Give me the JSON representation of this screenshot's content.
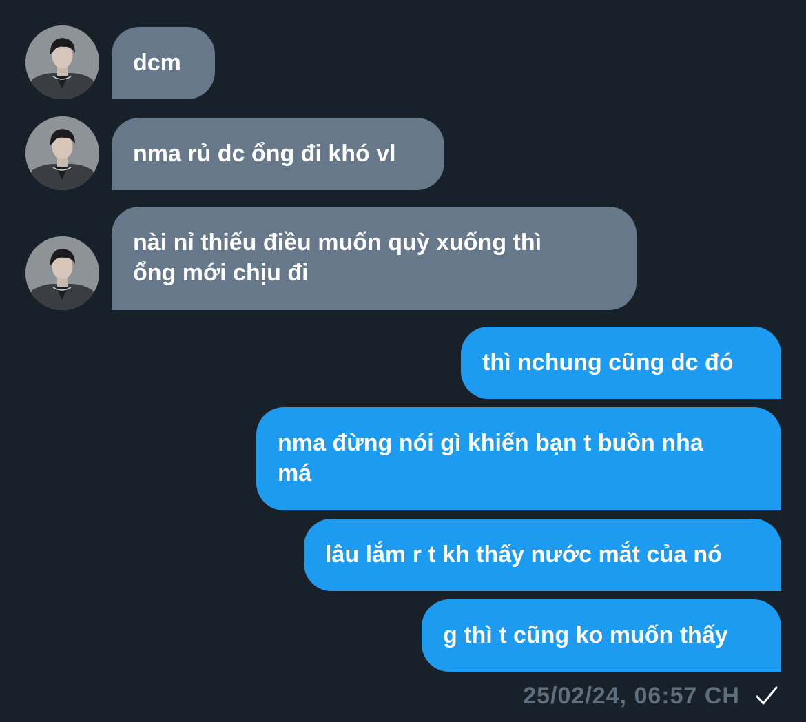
{
  "messages": {
    "incoming": [
      {
        "text": "dcm"
      },
      {
        "text": "nma rủ dc ổng đi khó vl"
      },
      {
        "line1": "nài nỉ thiếu điều muốn quỳ xuống thì",
        "line2": "ổng mới chịu đi"
      }
    ],
    "outgoing": [
      {
        "text": "thì nchung cũng dc đó"
      },
      {
        "line1": "nma đừng nói gì khiến bạn t buồn nha",
        "line2": "má"
      },
      {
        "text": "lâu lắm r t kh thấy nước mắt của nó"
      },
      {
        "text": "g thì t cũng ko muốn thấy"
      }
    ]
  },
  "status": {
    "timestamp": "25/02/24, 06:57 CH",
    "icon": "check-icon"
  },
  "colors": {
    "background": "#18202a",
    "incoming_bubble": "#66788a",
    "outgoing_bubble": "#1d9bf0",
    "timestamp": "#5f6e7c"
  }
}
